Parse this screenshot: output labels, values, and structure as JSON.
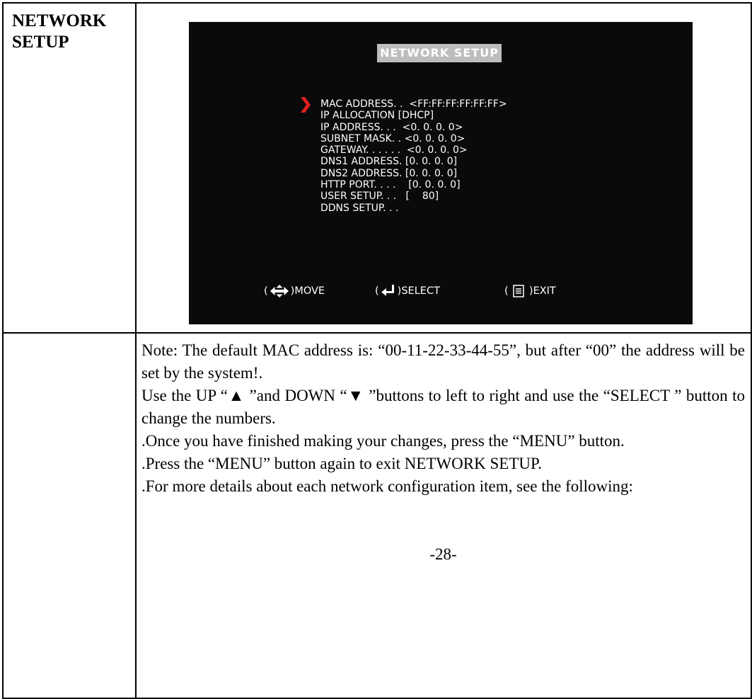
{
  "section": {
    "title_line1": "NETWORK",
    "title_line2": "SETUP"
  },
  "osd": {
    "title": "NETWORK SETUP",
    "items": [
      "MAC ADDRESS. .  <FF:FF:FF:FF:FF:FF>",
      "IP ALLOCATION [DHCP]",
      "IP ADDRESS. . .  <0. 0. 0. 0>",
      "SUBNET MASK. . <0. 0. 0. 0>",
      "GATEWAY. . . . . .  <0. 0. 0. 0>",
      "DNS1 ADDRESS. [0. 0. 0. 0]",
      "DNS2 ADDRESS. [0. 0. 0. 0]",
      "HTTP PORT. . . .    [0. 0. 0. 0]",
      "USER SETUP. . .   [    80]",
      "DDNS SETUP. . ."
    ],
    "footer": {
      "move": "MOVE",
      "select": "SELECT",
      "exit": "EXIT"
    }
  },
  "note": {
    "paragraphs": [
      "Note: The default MAC address is: “00-11-22-33-44-55”, but after “00” the address will be set by the system!.",
      "Use the UP “▲ ”and DOWN “▼ ”buttons to left to right and use the “SELECT ” button to change the numbers.",
      ".Once you have finished making your changes, press the “MENU” button.",
      ".Press the “MENU” button again to exit NETWORK SETUP.",
      ".For more details about each network configuration item, see the following:"
    ],
    "page_number": "-28-"
  },
  "colors": {
    "osd_background": "#0a0a0a",
    "osd_title_bar": "#bdbdbd",
    "cursor_arrow": "#e02020"
  },
  "icons": [
    "selection-arrow-icon",
    "move-arrows-icon",
    "enter-icon",
    "menu-icon"
  ]
}
